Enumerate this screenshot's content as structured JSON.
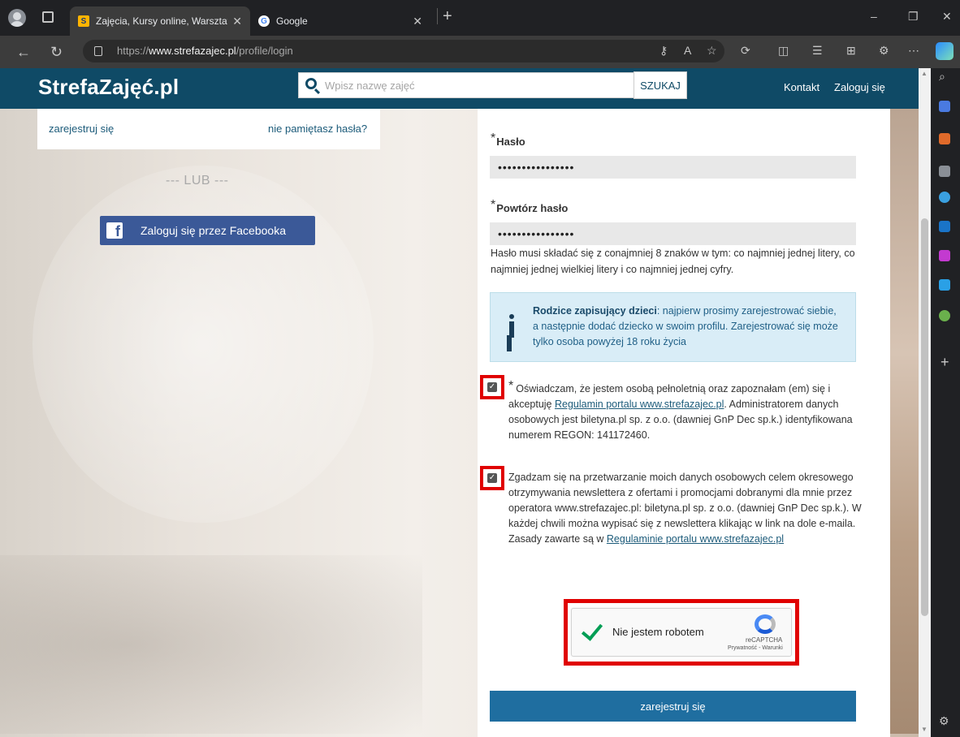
{
  "browser": {
    "tabs": [
      {
        "title": "Zajęcia, Kursy online, Warsztaty, F",
        "favicon": "S"
      },
      {
        "title": "Google",
        "favicon": "G"
      }
    ],
    "new_tab_label": "+",
    "url_prefix": "https://",
    "url_domain": "www.strefazajec.pl",
    "url_path": "/profile/login",
    "window_controls": {
      "minimize": "–",
      "restore": "❐",
      "close": "✕"
    }
  },
  "site": {
    "logo": "StrefaZajęć.pl",
    "search_placeholder": "Wpisz nazwę zajęć",
    "search_button": "SZUKAJ",
    "nav": {
      "contact": "Kontakt",
      "login": "Zaloguj się"
    }
  },
  "login_panel": {
    "register_link": "zarejestruj się",
    "forgot_link": "nie pamiętasz hasła?",
    "or_divider": "--- LUB ---",
    "facebook_button": "Zaloguj się przez Facebooka"
  },
  "register_form": {
    "password_label": "Hasło",
    "password_value": "••••••••••••••••",
    "repeat_label": "Powtórz hasło",
    "repeat_value": "••••••••••••••••",
    "required_mark": "*",
    "password_hint": "Hasło musi składać się z conajmniej 8 znaków w tym: co najmniej jednej litery, co najmniej jednej wielkiej litery i co najmniej jednej cyfry.",
    "info_bold": "Rodzice zapisujący dzieci",
    "info_text": ": najpierw prosimy zarejestrować siebie, a następnie dodać dziecko w swoim profilu. Zarejestrować się może tylko osoba powyżej 18 roku życia",
    "consent1_before": "Oświadczam, że jestem osobą pełnoletnią oraz zapoznałam (em) się i akceptuję ",
    "consent1_link": "Regulamin portalu www.strefazajec.pl",
    "consent1_after": ". Administratorem danych osobowych jest biletyna.pl sp. z o.o. (dawniej GnP Dec sp.k.) identyfikowana numerem REGON: 141172460.",
    "consent2_text": "Zgadzam się na przetwarzanie moich danych osobowych celem okresowego otrzymywania newslettera z ofertami i promocjami dobranymi dla mnie przez operatora www.strefazajec.pl: biletyna.pl sp. z o.o. (dawniej GnP Dec sp.k.). W każdej chwili można wypisać się z newslettera klikając w link na dole e-maila. Zasady zawarte są w ",
    "consent2_link": "Regulaminie portalu www.strefazajec.pl",
    "checkbox_mark": "✓",
    "captcha_label": "Nie jestem robotem",
    "captcha_brand": "reCAPTCHA",
    "captcha_terms": "Prywatność - Warunki",
    "submit_button": "zarejestruj się"
  },
  "colors": {
    "header": "#0f4a66",
    "submit": "#1f6ea0",
    "facebook": "#3b5998",
    "highlight": "#e00000",
    "info_bg": "#d9edf7"
  }
}
